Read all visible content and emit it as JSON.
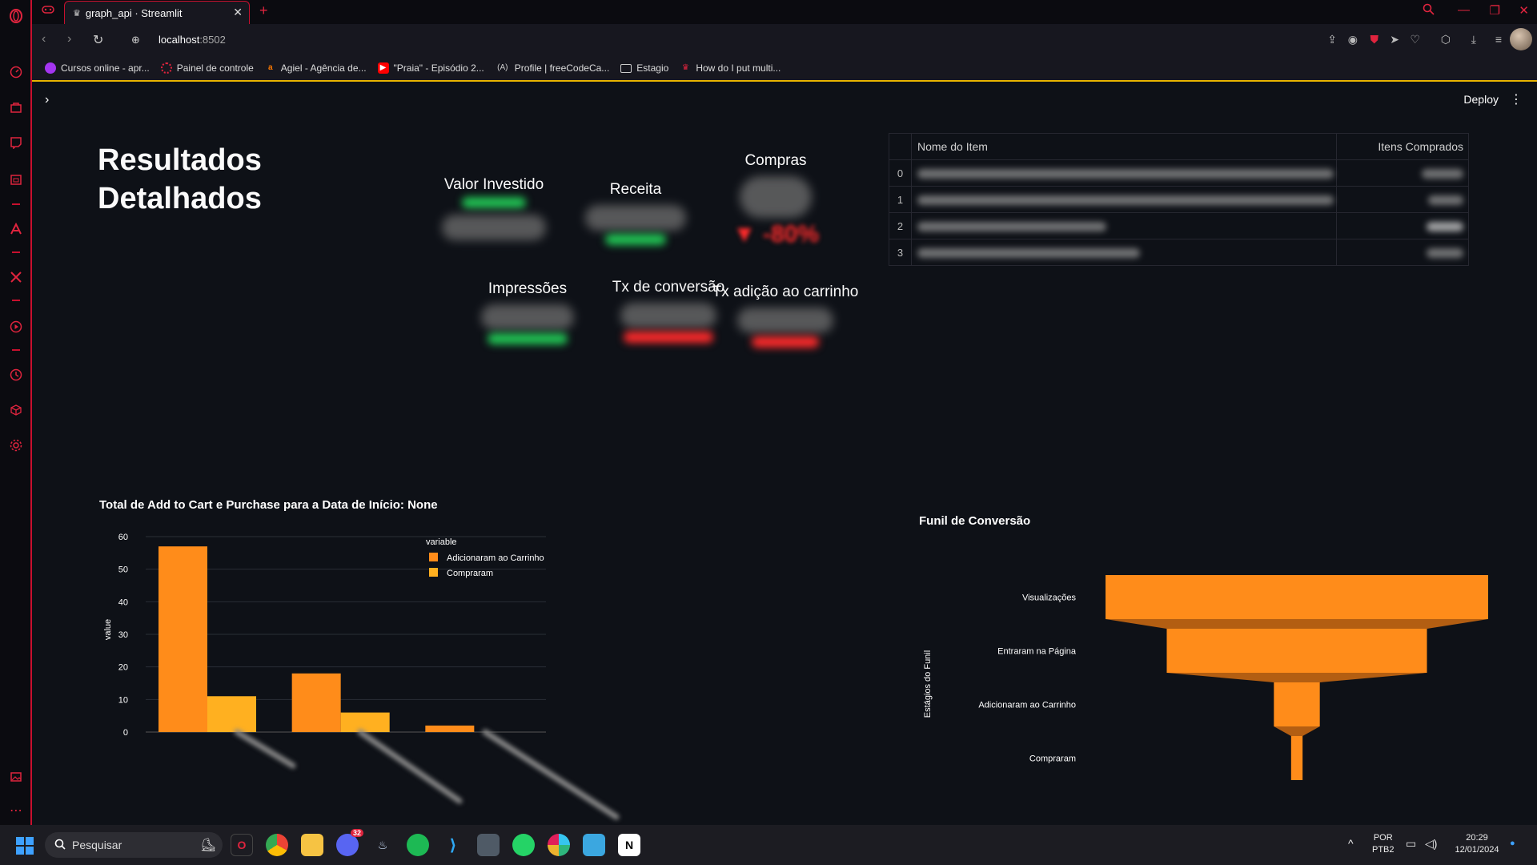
{
  "browser": {
    "tab_title": "graph_api · Streamlit",
    "url_host": "localhost",
    "url_port": ":8502",
    "bookmarks": [
      {
        "label": "Cursos online - apr...",
        "color": "#a435f0"
      },
      {
        "label": "Painel de controle",
        "color": "#e0243e"
      },
      {
        "label": "Agiel - Agência de...",
        "color": "#ff7a00"
      },
      {
        "label": "\"Praia\" - Episódio 2...",
        "color": "#ff0000"
      },
      {
        "label": "Profile | freeCodeCa...",
        "color": "#cccccc"
      },
      {
        "label": "Estagio",
        "color": "#cccccc"
      },
      {
        "label": "How do I put multi...",
        "color": "#e0243e"
      }
    ]
  },
  "app": {
    "deploy_label": "Deploy",
    "title_line1": "Resultados",
    "title_line2": "Detalhados",
    "metrics": {
      "valor_investido": "Valor Investido",
      "receita": "Receita",
      "compras": "Compras",
      "compras_delta": "-80%",
      "impressoes": "Impressões",
      "tx_conversao": "Tx de conversão",
      "tx_carrinho": "Tx adição ao carrinho"
    },
    "table": {
      "col_name": "Nome do Item",
      "col_qty": "Itens Comprados",
      "index": [
        "0",
        "1",
        "2",
        "3"
      ]
    }
  },
  "chart_data": [
    {
      "type": "bar",
      "title": "Total de Add to Cart e Purchase para a Data de Início: None",
      "ylabel": "value",
      "xlabel": "",
      "ylim": [
        0,
        60
      ],
      "yticks": [
        "0",
        "10",
        "20",
        "30",
        "40",
        "50",
        "60"
      ],
      "legend_title": "variable",
      "legend_position": "top-right",
      "series": [
        {
          "name": "Adicionaram ao Carrinho",
          "color": "#ff8c1a",
          "values": [
            57,
            18,
            2
          ]
        },
        {
          "name": "Compraram",
          "color": "#ffb020",
          "values": [
            11,
            6,
            0
          ]
        }
      ]
    },
    {
      "type": "funnel",
      "title": "Funil de Conversão",
      "ylabel": "Estágios do Funil",
      "stages": [
        "Visualizações",
        "Entraram na Página",
        "Adicionaram ao Carrinho",
        "Compraram"
      ],
      "relative_widths": [
        1.0,
        0.68,
        0.12,
        0.03
      ],
      "color": "#ff8c1a"
    }
  ],
  "taskbar": {
    "search_label": "Pesquisar",
    "lang1": "POR",
    "lang2": "PTB2",
    "time": "20:29",
    "date": "12/01/2024",
    "discord_badge": "32"
  }
}
